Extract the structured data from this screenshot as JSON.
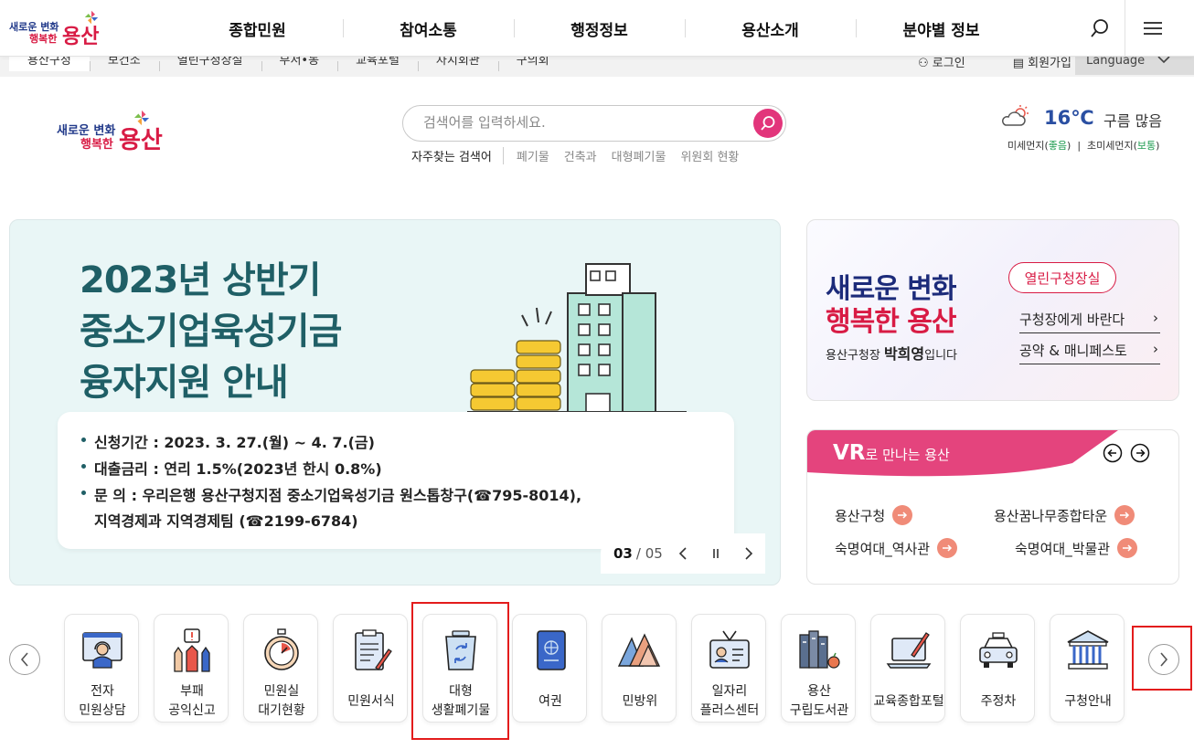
{
  "colors": {
    "accent": "#e2357b",
    "brand_red": "#d81b44",
    "brand_navy": "#223a8a",
    "highlight_box": "#e31c1c"
  },
  "top_nav": {
    "brand": {
      "line1": "새로운 변화",
      "line2": "행복한",
      "name": "용산"
    },
    "items": [
      "종합민원",
      "참여소통",
      "행정정보",
      "용산소개",
      "분야별 정보"
    ],
    "search_icon": "search-icon",
    "menu_icon": "hamburger-icon"
  },
  "util_bar": {
    "links": [
      "용산구청",
      "보건소",
      "열린구청장실",
      "부서•동",
      "교육포털",
      "자치회관",
      "구의회"
    ],
    "login": "로그인",
    "signup": "회원가입",
    "language": "Language"
  },
  "header": {
    "logo": {
      "line1": "새로운 변화",
      "line2": "행복한",
      "name": "용산"
    },
    "search": {
      "placeholder": "검색어를 입력하세요.",
      "popular_label": "자주찾는 검색어",
      "keywords": [
        "폐기물",
        "건축과",
        "대형폐기물",
        "위원회 현황"
      ]
    },
    "weather": {
      "icon": "partly-cloudy-icon",
      "temp": "16℃",
      "condition": "구름 많음",
      "fine_dust_label": "미세먼지",
      "fine_dust_value": "좋음",
      "ultrafine_dust_label": "초미세먼지",
      "ultrafine_dust_value": "보통"
    }
  },
  "banner": {
    "title_lines": [
      "2023년 상반기",
      "중소기업육성기금",
      "융자지원 안내"
    ],
    "info": [
      "신청기간 : 2023. 3. 27.(월) ~ 4. 7.(금)",
      "대출금리 : 연리 1.5%(2023년 한시 0.8%)",
      "문 의 : 우리은행 용산구청지점 중소기업육성기금 원스톱창구(☎795-8014),",
      "지역경제과 지역경제팀 (☎2199-6784)"
    ],
    "current": "03",
    "total": "/ 05"
  },
  "mayor_card": {
    "title1": "새로운 변화",
    "title2": "행복한 용산",
    "subtitle_prefix": "용산구청장",
    "mayor_name": "박희영",
    "subtitle_suffix": "입니다",
    "open_office_button": "열린구청장실",
    "links": [
      "구청장에게 바란다",
      "공약 & 매니페스토"
    ]
  },
  "vr_card": {
    "title_vr": "VR",
    "title_rest": "로 만나는 용산",
    "links": [
      "용산구청",
      "용산꿈나무종합타운",
      "숙명여대_역사관",
      "숙명여대_박물관"
    ]
  },
  "quick_menu": {
    "items": [
      {
        "label": "전자\n민원상담",
        "icon": "headset-monitor-icon"
      },
      {
        "label": "부패\n공익신고",
        "icon": "report-hands-icon"
      },
      {
        "label": "민원실\n대기현황",
        "icon": "stopwatch-icon"
      },
      {
        "label": "민원서식",
        "icon": "clipboard-pen-icon"
      },
      {
        "label": "대형\n생활폐기물",
        "icon": "recycle-bin-icon"
      },
      {
        "label": "여권",
        "icon": "passport-icon"
      },
      {
        "label": "민방위",
        "icon": "mountain-icon"
      },
      {
        "label": "일자리\n플러스센터",
        "icon": "id-badge-icon"
      },
      {
        "label": "용산\n구립도서관",
        "icon": "books-icon"
      },
      {
        "label": "교육종합포털",
        "icon": "laptop-pen-icon"
      },
      {
        "label": "주정차",
        "icon": "taxi-icon"
      },
      {
        "label": "구청안내",
        "icon": "government-building-icon"
      }
    ],
    "prev_icon": "chevron-left-icon",
    "next_icon": "chevron-right-icon"
  }
}
